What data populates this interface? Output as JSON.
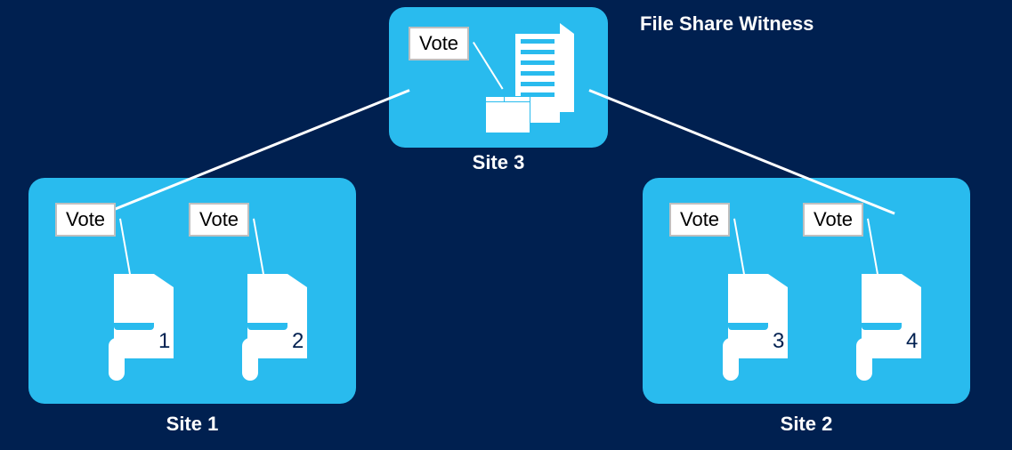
{
  "title": "File Share Witness",
  "sites": {
    "s1": {
      "label": "Site 1"
    },
    "s2": {
      "label": "Site 2"
    },
    "s3": {
      "label": "Site 3"
    }
  },
  "nodes": {
    "n1": {
      "vote": "Vote",
      "num": "1"
    },
    "n2": {
      "vote": "Vote",
      "num": "2"
    },
    "n3": {
      "vote": "Vote",
      "num": "3"
    },
    "n4": {
      "vote": "Vote",
      "num": "4"
    },
    "witness": {
      "vote": "Vote"
    }
  }
}
